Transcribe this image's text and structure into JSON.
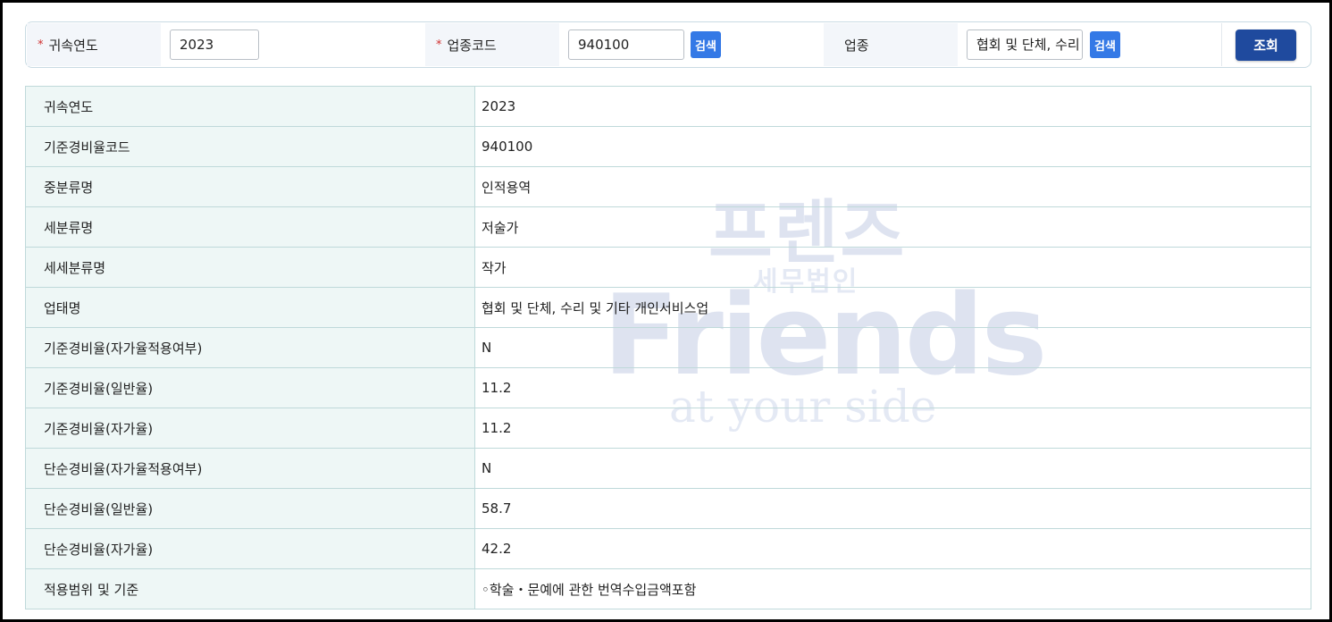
{
  "search": {
    "year_label": "귀속연도",
    "year_value": "2023",
    "code_label": "업종코드",
    "code_value": "940100",
    "code_search_button": "검색",
    "industry_label": "업종",
    "industry_value": "협회 및 단체, 수리 및 기타 개인서비스업",
    "industry_search_button": "검색",
    "query_button": "조회",
    "required_mark": "*"
  },
  "rows": [
    {
      "label": "귀속연도",
      "value": "2023"
    },
    {
      "label": "기준경비율코드",
      "value": "940100"
    },
    {
      "label": "중분류명",
      "value": "인적용역"
    },
    {
      "label": "세분류명",
      "value": "저술가"
    },
    {
      "label": "세세분류명",
      "value": "작가"
    },
    {
      "label": "업태명",
      "value": "협회 및 단체, 수리 및 기타 개인서비스업"
    },
    {
      "label": "기준경비율(자가율적용여부)",
      "value": "N"
    },
    {
      "label": "기준경비율(일반율)",
      "value": "11.2"
    },
    {
      "label": "기준경비율(자가율)",
      "value": "11.2"
    },
    {
      "label": "단순경비율(자가율적용여부)",
      "value": "N"
    },
    {
      "label": "단순경비율(일반율)",
      "value": "58.7"
    },
    {
      "label": "단순경비율(자가율)",
      "value": "42.2"
    },
    {
      "label": "적용범위 및 기준",
      "value": "◦학술・문예에 관한 번역수입금액포함"
    }
  ],
  "watermark": {
    "kr_title": "프렌즈",
    "kr_sub": "세무법인",
    "en_title": "Friends",
    "en_sub": "at your side"
  },
  "colors": {
    "search_button": "#3479e6",
    "query_button": "#1f4a9e",
    "header_cell": "#eef7f6",
    "border": "#bfd9da",
    "required": "#d0302f"
  }
}
